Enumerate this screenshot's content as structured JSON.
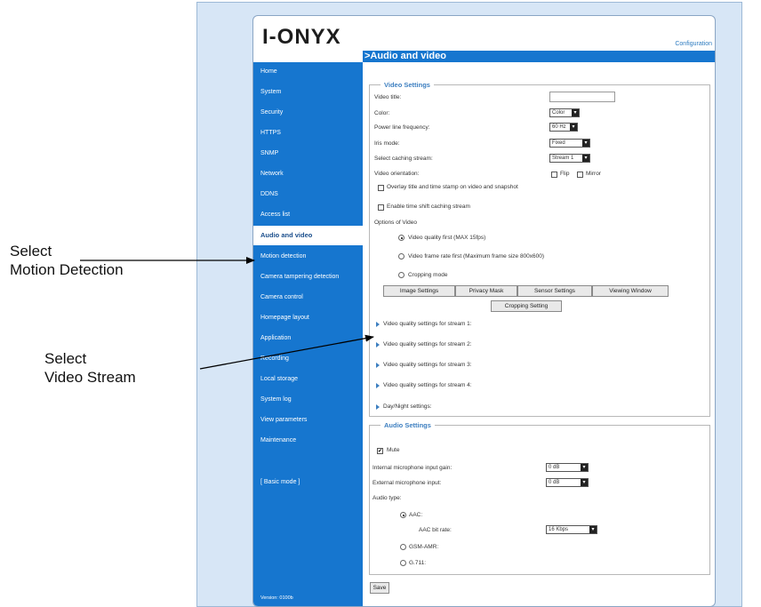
{
  "logo": "I-ONYX",
  "header": {
    "config_link": "Configuration",
    "page_title": ">Audio and video"
  },
  "sidebar": {
    "items": [
      {
        "label": "Home",
        "active": false
      },
      {
        "label": "System",
        "active": false
      },
      {
        "label": "Security",
        "active": false
      },
      {
        "label": "HTTPS",
        "active": false
      },
      {
        "label": "SNMP",
        "active": false
      },
      {
        "label": "Network",
        "active": false
      },
      {
        "label": "DDNS",
        "active": false
      },
      {
        "label": "Access list",
        "active": false
      },
      {
        "label": "Audio and video",
        "active": true
      },
      {
        "label": "Motion detection",
        "active": false
      },
      {
        "label": "Camera tampering detection",
        "active": false
      },
      {
        "label": "Camera control",
        "active": false
      },
      {
        "label": "Homepage layout",
        "active": false
      },
      {
        "label": "Application",
        "active": false
      },
      {
        "label": "Recording",
        "active": false
      },
      {
        "label": "Local storage",
        "active": false
      },
      {
        "label": "System log",
        "active": false
      },
      {
        "label": "View parameters",
        "active": false
      },
      {
        "label": "Maintenance",
        "active": false
      }
    ],
    "basic_mode": "[ Basic mode ]",
    "version": "Version: 0100b"
  },
  "video": {
    "legend": "Video Settings",
    "title_label": "Video title:",
    "title_value": "",
    "color_label": "Color:",
    "color_value": "Color",
    "power_label": "Power line frequency:",
    "power_value": "60 Hz",
    "iris_label": "Iris mode:",
    "iris_value": "Fixed",
    "stream_label": "Select caching stream:",
    "stream_value": "Stream 1",
    "orient_label": "Video orientation:",
    "flip_label": "Flip",
    "mirror_label": "Mirror",
    "overlay_label": "Overlay title and time stamp on video and snapshot",
    "timeshift_label": "Enable time shift caching stream",
    "options_label": "Options of Video",
    "opt_quality": "Video quality first (MAX 15fps)",
    "opt_framerate": "Video frame rate first (Maximum frame size 800x600)",
    "opt_cropping": "Cropping mode",
    "btn_image": "Image Settings",
    "btn_privacy": "Privacy Mask",
    "btn_sensor": "Sensor Settings",
    "btn_viewing": "Viewing Window",
    "btn_cropping": "Cropping Setting",
    "stream1": "Video quality settings for stream 1:",
    "stream2": "Video quality settings for stream 2:",
    "stream3": "Video quality settings for stream 3:",
    "stream4": "Video quality settings for stream 4:",
    "daynight": "Day/Night settings:"
  },
  "audio": {
    "legend": "Audio Settings",
    "mute_label": "Mute",
    "int_gain_label": "Internal microphone input gain:",
    "int_gain_value": "0 dB",
    "ext_input_label": "External microphone input:",
    "ext_input_value": "0 dB",
    "type_label": "Audio type:",
    "aac_label": "AAC:",
    "aac_rate_label": "AAC bit rate:",
    "aac_rate_value": "16 Kbps",
    "gsm_label": "GSM-AMR:",
    "g711_label": "G.711:"
  },
  "save_label": "Save",
  "annotations": {
    "motion_1": "Select",
    "motion_2": "Motion Detection",
    "stream_1": "Select",
    "stream_2": "Video Stream"
  },
  "colors": {
    "accent": "#1676cf",
    "legend": "#3d7fc0"
  }
}
